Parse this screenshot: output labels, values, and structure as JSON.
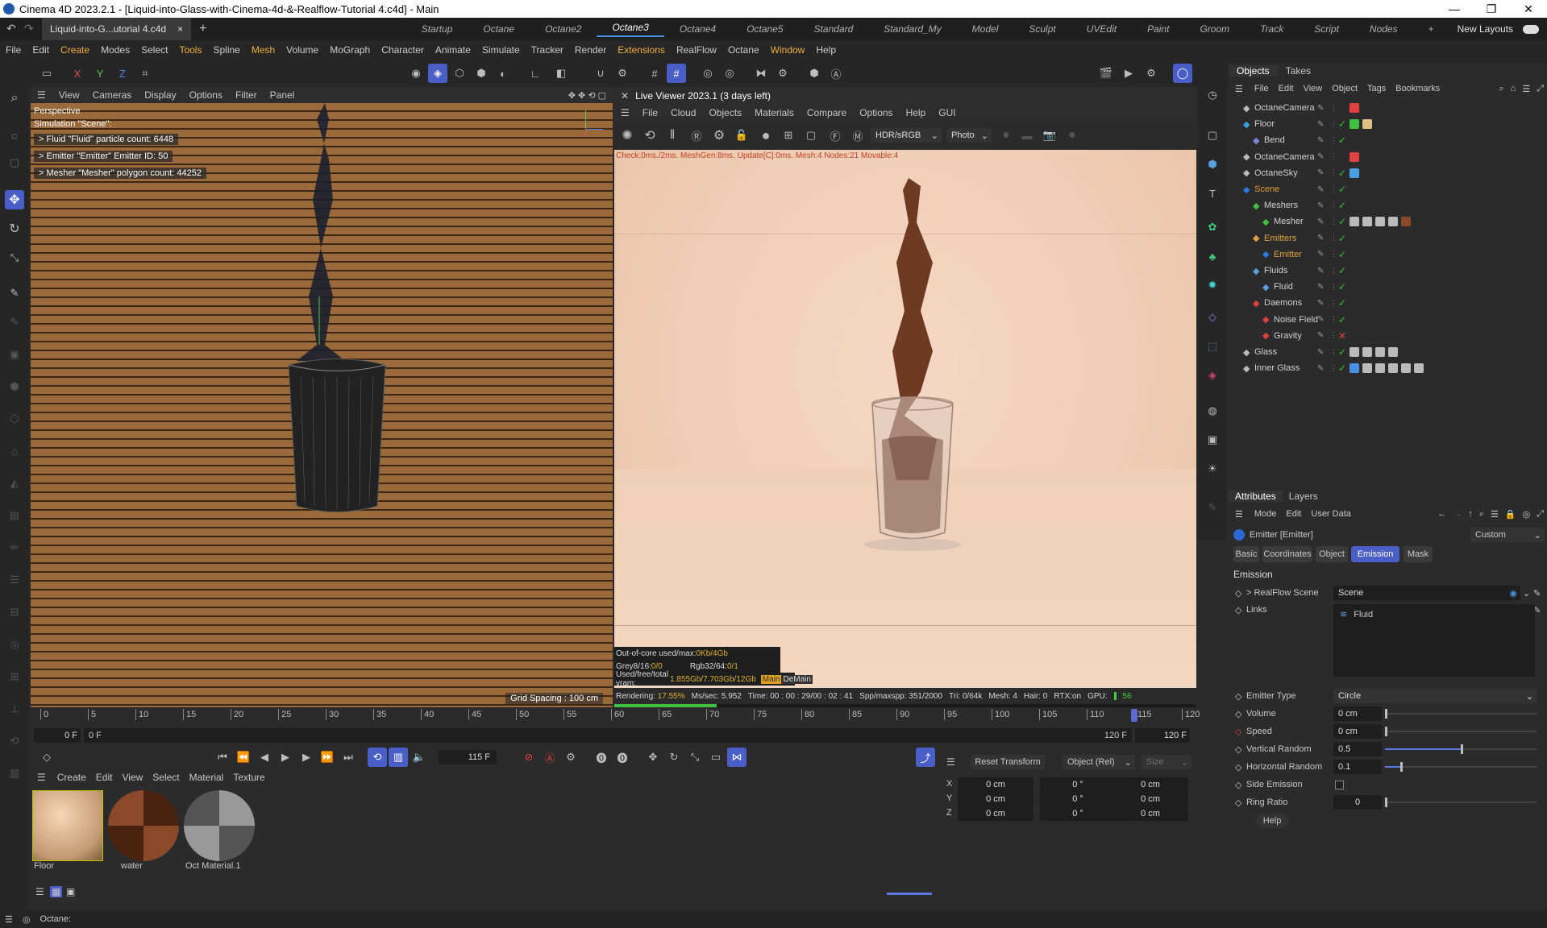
{
  "window": {
    "title": "Cinema 4D 2023.2.1 - [Liquid-into-Glass-with-Cinema-4d-&-Realflow-Tutorial 4.c4d] - Main"
  },
  "doc_tab": {
    "label": "Liquid-into-G...utorial 4.c4d",
    "close": "×",
    "add": "+"
  },
  "layout_tabs": [
    "Startup",
    "Octane",
    "Octane2",
    "Octane3",
    "Octane4",
    "Octane5",
    "Standard",
    "Standard_My",
    "Model",
    "Sculpt",
    "UVEdit",
    "Paint",
    "Groom",
    "Track",
    "Script",
    "Nodes"
  ],
  "layout_active": "Octane3",
  "new_layouts": "New Layouts",
  "menu": [
    "File",
    "Edit",
    "Create",
    "Modes",
    "Select",
    "Tools",
    "Spline",
    "Mesh",
    "Volume",
    "MoGraph",
    "Character",
    "Animate",
    "Simulate",
    "Tracker",
    "Render",
    "Extensions",
    "RealFlow",
    "Octane",
    "Window",
    "Help"
  ],
  "axis_buttons": [
    "X",
    "Y",
    "Z"
  ],
  "viewport": {
    "menu": [
      "View",
      "Cameras",
      "Display",
      "Options",
      "Filter",
      "Panel"
    ],
    "camera": "Perspective",
    "sim_label": "Simulation \"Scene\":",
    "hud": [
      "> Fluid \"Fluid\" particle count: 6448",
      "> Emitter \"Emitter\" Emitter ID: 50",
      "> Mesher \"Mesher\" polygon count: 44252"
    ],
    "grid_spacing": "Grid Spacing : 100 cm"
  },
  "live_viewer": {
    "title": "Live Viewer 2023.1 (3 days left)",
    "menu": [
      "File",
      "Cloud",
      "Objects",
      "Materials",
      "Compare",
      "Options",
      "Help",
      "GUI"
    ],
    "color_mode": "HDR/sRGB",
    "tonemap": "Photo",
    "check_line": "Check:0ms./2ms. MeshGen:8ms. Update[C]:0ms. Mesh:4 Nodes:21 Movable:4",
    "stats": {
      "ooc": "Out-of-core used/max:",
      "ooc_val": "0Kb/4Gb",
      "grey": "Grey8/16:",
      "grey_val": "0/0",
      "rgb": "Rgb32/64:",
      "rgb_val": "0/1",
      "vram": "Used/free/total vram:",
      "vram_val": "1.855Gb/7.703Gb/12Gb",
      "main": "Main",
      "demain": "DeMain"
    },
    "status": {
      "rendering": "Rendering:",
      "rendering_val": "17.55%",
      "mssec": "Ms/sec: 5.952",
      "time": "Time: 00 : 00 : 29/00 : 02 : 41",
      "spp": "Spp/maxspp: 351/2000",
      "tri": "Tri: 0/64k",
      "mesh": "Mesh: 4",
      "hair": "Hair: 0",
      "rtx": "RTX:on",
      "gpu": "GPU:",
      "gpu_val": "56"
    },
    "progress": 0.1755
  },
  "timeline": {
    "ticks": [
      "0",
      "5",
      "10",
      "15",
      "20",
      "25",
      "30",
      "35",
      "40",
      "45",
      "50",
      "55",
      "60",
      "65",
      "70",
      "75",
      "80",
      "85",
      "90",
      "95",
      "100",
      "105",
      "110",
      "115",
      "120"
    ],
    "start_field": "0 F",
    "start2": "0 F",
    "end1": "120 F",
    "end2": "120 F",
    "current_frame": "115 F",
    "playhead_frame": 115
  },
  "materials": {
    "menu": [
      "Create",
      "Edit",
      "View",
      "Select",
      "Material",
      "Texture"
    ],
    "items": [
      {
        "name": "Floor"
      },
      {
        "name": "water"
      },
      {
        "name": "Oct Material.1"
      }
    ]
  },
  "coords": {
    "reset": "Reset Transform",
    "mode": "Object (Rel)",
    "size": "Size",
    "rows": [
      {
        "axis": "X",
        "pos": "0 cm",
        "rot": "0 °",
        "size": "0 cm"
      },
      {
        "axis": "Y",
        "pos": "0 cm",
        "rot": "0 °",
        "size": "0 cm"
      },
      {
        "axis": "Z",
        "pos": "0 cm",
        "rot": "0 °",
        "size": "0 cm"
      }
    ]
  },
  "objects_panel": {
    "tabs": [
      "Objects",
      "Takes"
    ],
    "menu": [
      "File",
      "Edit",
      "View",
      "Object",
      "Tags",
      "Bookmarks"
    ],
    "rows": [
      {
        "name": "OctaneCamera",
        "color": "#d0d0d0"
      },
      {
        "name": "Floor",
        "color": "#d0d0d0"
      },
      {
        "name": "Bend",
        "color": "#d0d0d0"
      },
      {
        "name": "OctaneCamera",
        "color": "#d0d0d0"
      },
      {
        "name": "OctaneSky",
        "color": "#d0d0d0"
      },
      {
        "name": "Scene",
        "color": "#e0a040"
      },
      {
        "name": "Meshers",
        "color": "#d0d0d0"
      },
      {
        "name": "Mesher",
        "color": "#d0d0d0"
      },
      {
        "name": "Emitters",
        "color": "#e0a040"
      },
      {
        "name": "Emitter",
        "color": "#e0a040"
      },
      {
        "name": "Fluids",
        "color": "#d0d0d0"
      },
      {
        "name": "Fluid",
        "color": "#d0d0d0"
      },
      {
        "name": "Daemons",
        "color": "#d0d0d0"
      },
      {
        "name": "Noise Field",
        "color": "#d0d0d0"
      },
      {
        "name": "Gravity",
        "color": "#d0d0d0"
      },
      {
        "name": "Glass",
        "color": "#d0d0d0"
      },
      {
        "name": "Inner Glass",
        "color": "#d0d0d0"
      }
    ]
  },
  "attributes": {
    "tabs": [
      "Attributes",
      "Layers"
    ],
    "menu": [
      "Mode",
      "Edit",
      "User Data"
    ],
    "object": "Emitter [Emitter]",
    "preset": "Custom",
    "subtabs": [
      "Basic",
      "Coordinates",
      "Object",
      "Emission",
      "Mask"
    ],
    "subtab_active": "Emission",
    "section": "Emission",
    "realflow_scene_label": "> RealFlow Scene",
    "realflow_scene_val": "Scene",
    "links_label": "Links",
    "links_val": "Fluid",
    "emitter_type_label": "Emitter Type",
    "emitter_type_val": "Circle",
    "params": [
      {
        "label": "Volume",
        "value": "0 cm",
        "fill": 0.0
      },
      {
        "label": "Speed",
        "value": "0 cm",
        "fill": 0.0
      },
      {
        "label": "Vertical Random",
        "value": "0.5",
        "fill": 0.5
      },
      {
        "label": "Horizontal Random",
        "value": "0.1",
        "fill": 0.1
      }
    ],
    "side_emission": "Side Emission",
    "ring_ratio": "Ring Ratio",
    "ring_ratio_val": "0",
    "help": "Help"
  },
  "status_bar": {
    "text": "Octane:"
  }
}
